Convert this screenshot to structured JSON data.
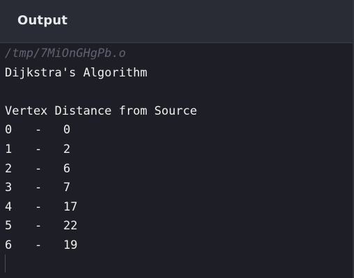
{
  "header": {
    "title": "Output"
  },
  "console": {
    "path": "/tmp/7MiOnGHgPb.o",
    "heading": "Dijkstra's Algorithm",
    "blank": "",
    "table_header": "Vertex Distance from Source",
    "rows": [
      {
        "vertex": "0",
        "sep": "-",
        "distance": "0"
      },
      {
        "vertex": "1",
        "sep": "-",
        "distance": "2"
      },
      {
        "vertex": "2",
        "sep": "-",
        "distance": "6"
      },
      {
        "vertex": "3",
        "sep": "-",
        "distance": "7"
      },
      {
        "vertex": "4",
        "sep": "-",
        "distance": "17"
      },
      {
        "vertex": "5",
        "sep": "-",
        "distance": "22"
      },
      {
        "vertex": "6",
        "sep": "-",
        "distance": "19"
      }
    ]
  }
}
